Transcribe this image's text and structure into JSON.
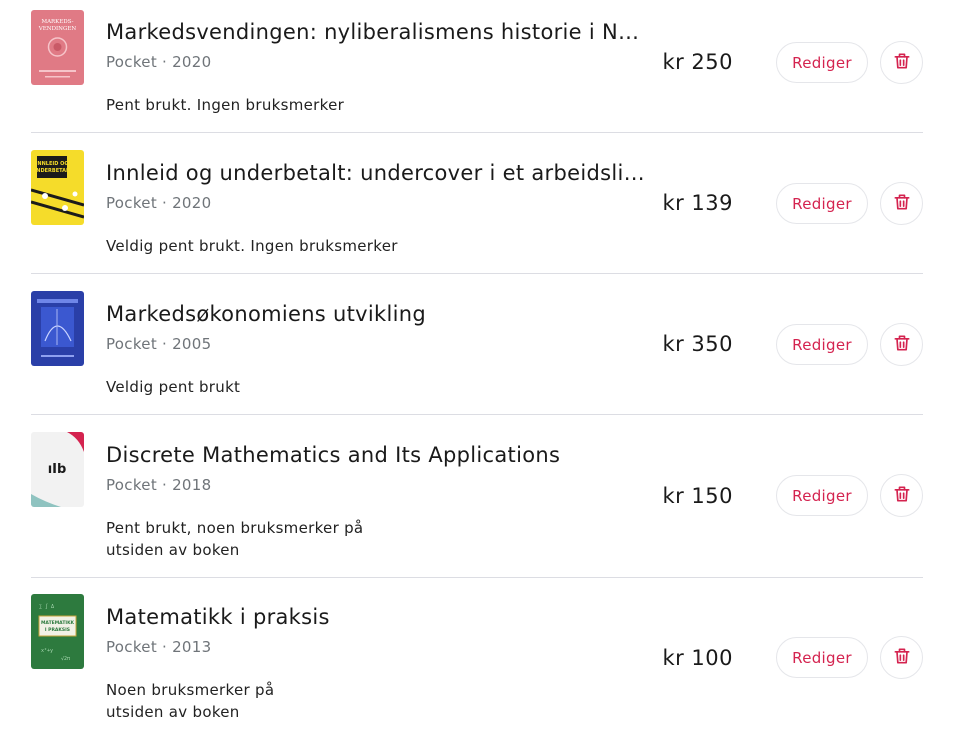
{
  "listings": [
    {
      "title": "Markedsvendingen: nyliberalismens historie i Norge",
      "format": "Pocket",
      "separator": "·",
      "year": "2020",
      "description": "Pent brukt. Ingen bruksmerker",
      "price": "kr 250",
      "edit_label": "Rediger",
      "cover_text": "MARKEDS-VENDINGEN",
      "cover_color": "#e07a85"
    },
    {
      "title": "Innleid og underbetalt: undercover i et arbeidsliv i endring",
      "format": "Pocket",
      "separator": "·",
      "year": "2020",
      "description": "Veldig pent brukt. Ingen bruksmerker",
      "price": "kr 139",
      "edit_label": "Rediger",
      "cover_text": "INNLEID OG UNDERBETALT",
      "cover_color": "#f5dc2a"
    },
    {
      "title": "Markedsøkonomiens utvikling",
      "format": "Pocket",
      "separator": "·",
      "year": "2005",
      "description": "Veldig pent brukt",
      "price": "kr 350",
      "edit_label": "Rediger",
      "cover_color": "#2a3fa8"
    },
    {
      "title": "Discrete Mathematics and Its Applications",
      "format": "Pocket",
      "separator": "·",
      "year": "2018",
      "description": "Pent brukt, noen bruksmerker på utsiden av boken",
      "price": "kr 150",
      "edit_label": "Rediger",
      "cover_text": "ıIb",
      "cover_color": "#f2f2f2"
    },
    {
      "title": "Matematikk i praksis",
      "format": "Pocket",
      "separator": "·",
      "year": "2013",
      "description": "Noen bruksmerker på utsiden av boken",
      "price": "kr 100",
      "edit_label": "Rediger",
      "cover_text": "MATEMATIKK I PRAKSIS",
      "cover_color": "#2d7a3e"
    }
  ],
  "colors": {
    "accent": "#d4234f",
    "divider": "#dcdde3",
    "meta_text": "#6f7479"
  },
  "icons": {
    "delete": "trash-icon"
  }
}
